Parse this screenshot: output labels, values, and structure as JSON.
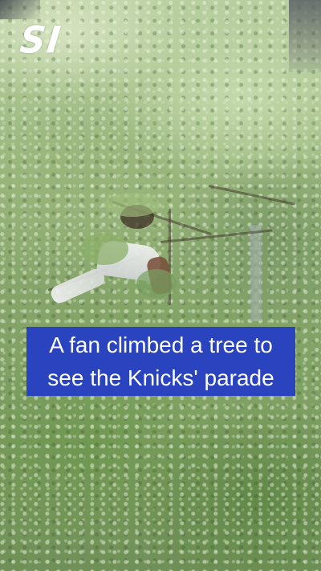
{
  "logo": {
    "text": "SI"
  },
  "caption": {
    "line1": "A fan climbed a tree to",
    "line2": "see the Knicks' parade",
    "background_color": "#2a44c0",
    "text_color": "#ffffff"
  }
}
